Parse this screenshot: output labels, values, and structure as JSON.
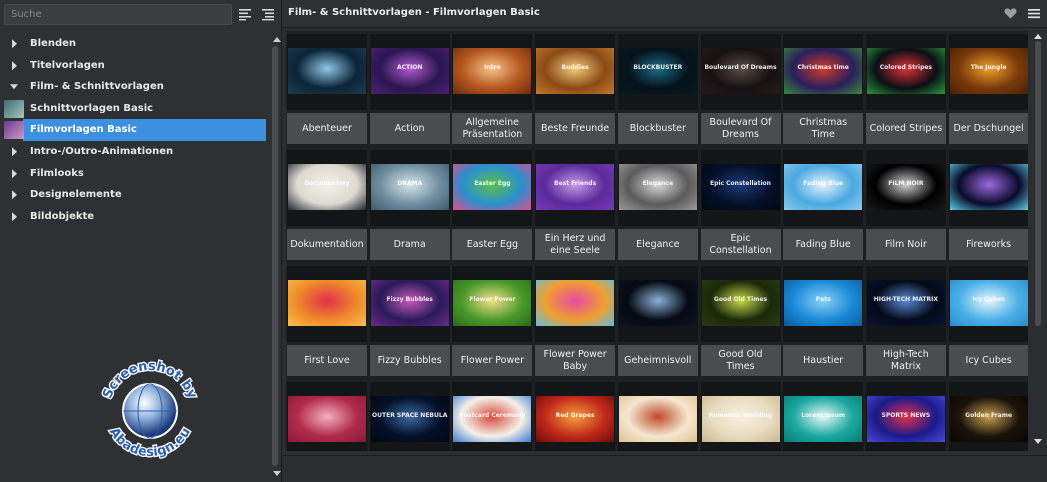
{
  "sidebar": {
    "search_placeholder": "Suche",
    "sort_icon": "align-left-icon",
    "filter_icon": "list-indent-icon",
    "tree": [
      {
        "label": "Blenden",
        "expanded": false,
        "child": false
      },
      {
        "label": "Titelvorlagen",
        "expanded": false,
        "child": false
      },
      {
        "label": "Film- & Schnittvorlagen",
        "expanded": true,
        "child": false
      },
      {
        "label": "Schnittvorlagen Basic",
        "child": true,
        "selected": false,
        "thumb": [
          "#3a6a78",
          "#a9c9b8"
        ]
      },
      {
        "label": "Filmvorlagen Basic",
        "child": true,
        "selected": true,
        "thumb": [
          "#6a3a8a",
          "#d09acc"
        ]
      },
      {
        "label": "Intro-/Outro-Animationen",
        "expanded": false,
        "child": false
      },
      {
        "label": "Filmlooks",
        "expanded": false,
        "child": false
      },
      {
        "label": "Designelemente",
        "expanded": false,
        "child": false
      },
      {
        "label": "Bildobjekte",
        "expanded": false,
        "child": false
      }
    ]
  },
  "header": {
    "title": "Film- & Schnittvorlagen - Filmvorlagen Basic",
    "heart_icon": "heart-icon",
    "menu_icon": "hamburger-menu-icon"
  },
  "templates": [
    {
      "name": "Abenteuer",
      "thumb_text": "",
      "colors": [
        "#0b2438",
        "#8fc7e8",
        "#1f3a4d"
      ]
    },
    {
      "name": "Action",
      "thumb_text": "ACTION",
      "colors": [
        "#2a1650",
        "#b05ad0",
        "#4c2070"
      ]
    },
    {
      "name": "Allgemeine Präsentation",
      "thumb_text": "Intro",
      "colors": [
        "#b5571e",
        "#f6c08a",
        "#6a2a12"
      ]
    },
    {
      "name": "Beste Freunde",
      "thumb_text": "Buddies",
      "colors": [
        "#8a4a16",
        "#f3c979",
        "#c07a2c"
      ]
    },
    {
      "name": "Blockbuster",
      "thumb_text": "BLOCKBUSTER",
      "colors": [
        "#05121a",
        "#1b6c84",
        "#061820"
      ]
    },
    {
      "name": "Boulevard Of Dreams",
      "thumb_text": "Boulevard Of Dreams",
      "colors": [
        "#171012",
        "#5a4c48",
        "#251a1a"
      ]
    },
    {
      "name": "Christmas Time",
      "thumb_text": "Christmas time",
      "colors": [
        "#2a1e5c",
        "#d23a2a",
        "#3a8a3a"
      ]
    },
    {
      "name": "Colored Stripes",
      "thumb_text": "Colored Stripes",
      "colors": [
        "#0a0f14",
        "#e0303a",
        "#2a9a3a"
      ]
    },
    {
      "name": "Der Dschungel",
      "thumb_text": "The Jungle",
      "colors": [
        "#7a3a0a",
        "#f0a02a",
        "#4a2006"
      ]
    },
    {
      "name": "Dokumentation",
      "thumb_text": "Documentary",
      "colors": [
        "#dedad0",
        "#f4f1ea",
        "#1c2230"
      ]
    },
    {
      "name": "Drama",
      "thumb_text": "DRAMA",
      "colors": [
        "#6f8ea0",
        "#d8e6ea",
        "#3a5a6a"
      ]
    },
    {
      "name": "Easter Egg",
      "thumb_text": "Easter Egg",
      "colors": [
        "#2a8fd0",
        "#59c04a",
        "#e84a8a"
      ]
    },
    {
      "name": "Ein Herz und eine Seele",
      "thumb_text": "Best Friends",
      "colors": [
        "#5a2a9a",
        "#c89ae8",
        "#7a3ab8"
      ]
    },
    {
      "name": "Elegance",
      "thumb_text": "Elegance",
      "colors": [
        "#5a5a5a",
        "#d8d8d8",
        "#9a9a9a"
      ]
    },
    {
      "name": "Epic Constellation",
      "thumb_text": "Epic Constellation",
      "colors": [
        "#041028",
        "#1a3a7a",
        "#020812"
      ]
    },
    {
      "name": "Fading Blue",
      "thumb_text": "Fading Blue",
      "colors": [
        "#4aa8e0",
        "#e6f4fc",
        "#8ccbee"
      ]
    },
    {
      "name": "Film Noir",
      "thumb_text": "FILM NOIR",
      "colors": [
        "#000000",
        "#d0d0d0",
        "#1a1a1a"
      ]
    },
    {
      "name": "Fireworks",
      "thumb_text": "",
      "colors": [
        "#0a0a2a",
        "#9a6ae0",
        "#5ad0e8"
      ]
    },
    {
      "name": "First Love",
      "thumb_text": "",
      "colors": [
        "#f08a2a",
        "#e0304a",
        "#f4c04a"
      ]
    },
    {
      "name": "Fizzy Bubbles",
      "thumb_text": "Fizzy Bubbles",
      "colors": [
        "#2a1a5a",
        "#c85ab8",
        "#6a2a8a"
      ]
    },
    {
      "name": "Flower Power",
      "thumb_text": "Flower Power",
      "colors": [
        "#4a9a2a",
        "#f4e08a",
        "#2a6a1a"
      ]
    },
    {
      "name": "Flower Power Baby",
      "thumb_text": "",
      "colors": [
        "#f0a030",
        "#e84aa0",
        "#5ac0e0"
      ]
    },
    {
      "name": "Geheimnisvoll",
      "thumb_text": "",
      "colors": [
        "#050a12",
        "#8ab0d8",
        "#0a1422"
      ]
    },
    {
      "name": "Good Old Times",
      "thumb_text": "Good Old Times",
      "colors": [
        "#1a2a0a",
        "#c8d84a",
        "#2a3a10"
      ]
    },
    {
      "name": "Haustier",
      "thumb_text": "Pets",
      "colors": [
        "#1a8ad8",
        "#8ad0f4",
        "#0a5a9a"
      ]
    },
    {
      "name": "High-Tech Matrix",
      "thumb_text": "HIGH-TECH MATRIX",
      "colors": [
        "#040a1a",
        "#5a8ad8",
        "#0a1430"
      ]
    },
    {
      "name": "Icy Cubes",
      "thumb_text": "Icy Cubes",
      "colors": [
        "#4ab0e8",
        "#e8f6fc",
        "#2a8ac8"
      ]
    },
    {
      "name": "",
      "thumb_text": "",
      "colors": [
        "#b02a4a",
        "#f4b0c0",
        "#8a1a3a"
      ]
    },
    {
      "name": "",
      "thumb_text": "OUTER SPACE NEBULA",
      "colors": [
        "#041028",
        "#3a6aa0",
        "#020814"
      ]
    },
    {
      "name": "",
      "thumb_text": "Postcard Ceremony",
      "colors": [
        "#f4f0e8",
        "#d84a3a",
        "#3a7ad0"
      ]
    },
    {
      "name": "",
      "thumb_text": "Red Grapes",
      "colors": [
        "#c02a1a",
        "#f4a03a",
        "#6a0a0a"
      ]
    },
    {
      "name": "",
      "thumb_text": "",
      "colors": [
        "#f4e8d0",
        "#c04a2a",
        "#e0c090"
      ]
    },
    {
      "name": "",
      "thumb_text": "Romantic Wedding",
      "colors": [
        "#e8dcc0",
        "#f8f0e0",
        "#c8b890"
      ]
    },
    {
      "name": "",
      "thumb_text": "Lorem Ipsum",
      "colors": [
        "#1aa8a0",
        "#e8f8f6",
        "#0a7a74"
      ]
    },
    {
      "name": "",
      "thumb_text": "SPORTS NEWS",
      "colors": [
        "#1a1a8a",
        "#e0304a",
        "#4a4ad8"
      ]
    },
    {
      "name": "",
      "thumb_text": "Golden Frame",
      "colors": [
        "#1a120a",
        "#c8a050",
        "#0a0604"
      ]
    }
  ],
  "watermark": {
    "line1": "Screenshot by",
    "line2": "Abadesign.eu",
    "colors": [
      "#2a5fae",
      "#ffffff"
    ]
  }
}
